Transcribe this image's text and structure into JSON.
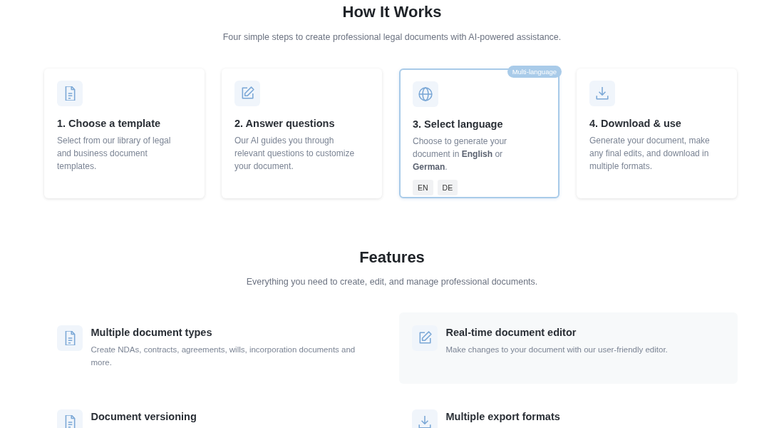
{
  "how_it_works": {
    "title": "How It Works",
    "subtitle": "Four simple steps to create professional legal documents with AI-powered assistance.",
    "steps": [
      {
        "kind": "document",
        "title": "1. Choose a template",
        "description": "Select from our library of legal and business document templates.",
        "featured": false
      },
      {
        "kind": "edit",
        "title": "2. Answer questions",
        "description": "Our AI guides you through relevant questions to customize your document.",
        "featured": false
      },
      {
        "kind": "globe",
        "title": "3. Select language",
        "description": "Choose to generate your document in **English** or **German**.",
        "featured": true,
        "badge": "Multi-language",
        "languages": [
          "EN",
          "DE"
        ]
      },
      {
        "kind": "download",
        "title": "4. Download & use",
        "description": "Generate your document, make any final edits, and download in multiple formats.",
        "featured": false
      }
    ]
  },
  "features": {
    "title": "Features",
    "subtitle": "Everything you need to create, edit, and manage professional documents.",
    "items": [
      {
        "kind": "document",
        "title": "Multiple document types",
        "description": "Create NDAs, contracts, agreements, wills, incorporation documents and more.",
        "highlighted": false
      },
      {
        "kind": "edit",
        "title": "Real-time document editor",
        "description": "Make changes to your document with our user-friendly editor.",
        "highlighted": true
      },
      {
        "kind": "document",
        "title": "Document versioning",
        "highlighted": false
      },
      {
        "kind": "download",
        "title": "Multiple export formats",
        "highlighted": false
      }
    ]
  }
}
